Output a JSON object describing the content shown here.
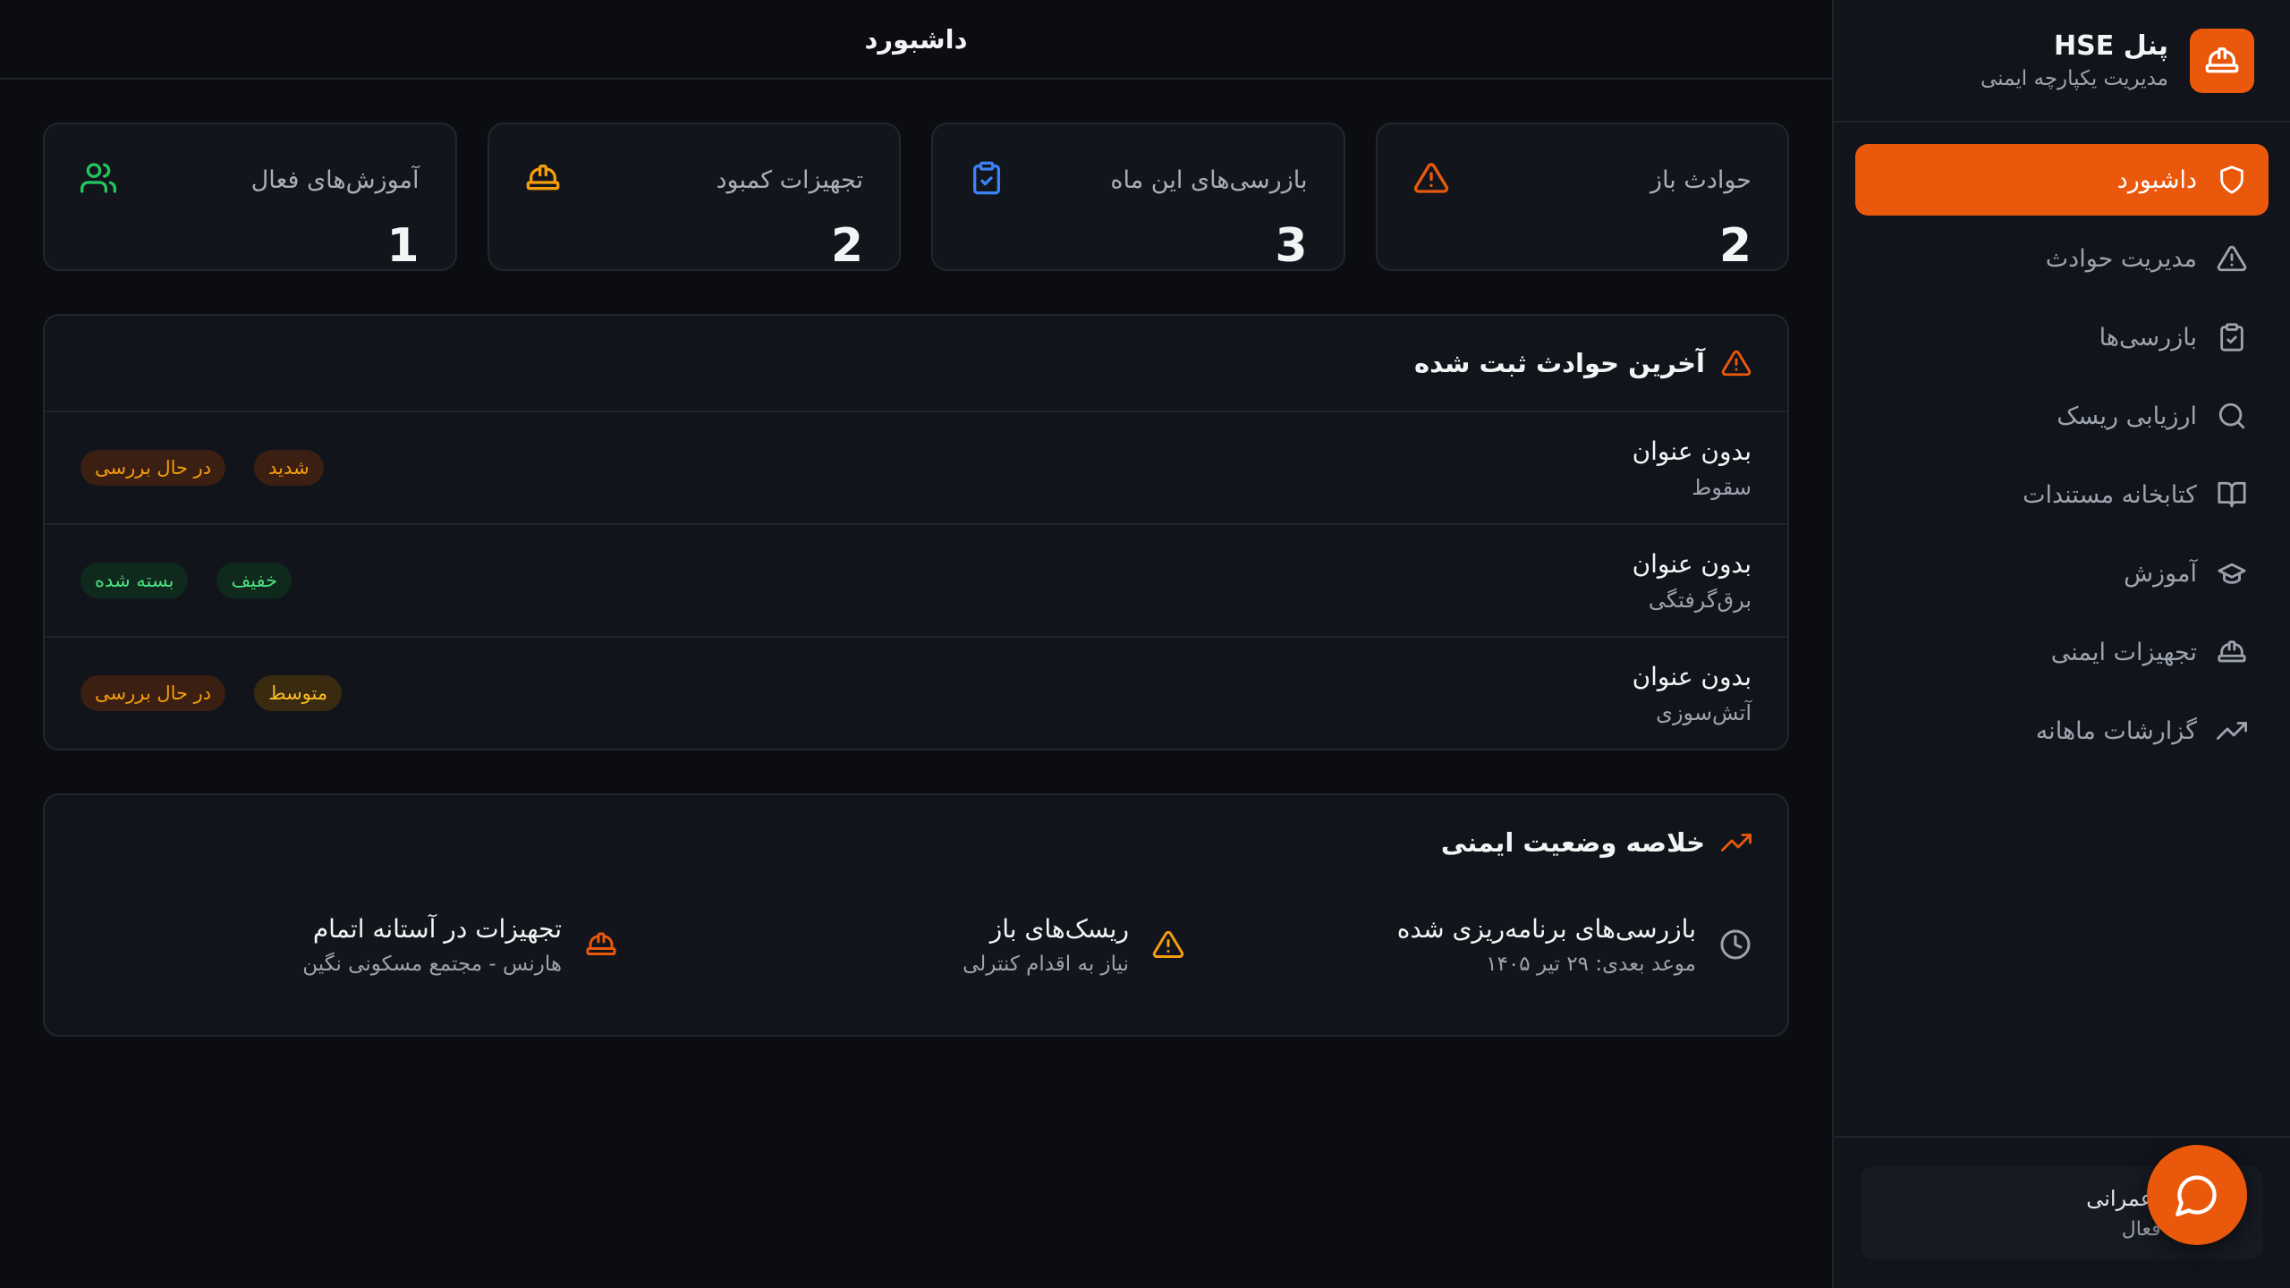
{
  "brand": {
    "title": "پنل HSE",
    "subtitle": "مدیریت یکپارچه ایمنی"
  },
  "sidebar": {
    "items": [
      {
        "label": "داشبورد",
        "icon": "shield-icon",
        "active": true
      },
      {
        "label": "مدیریت حوادث",
        "icon": "alert-triangle-icon"
      },
      {
        "label": "بازرسی‌ها",
        "icon": "clipboard-check-icon"
      },
      {
        "label": "ارزیابی ریسک",
        "icon": "search-icon"
      },
      {
        "label": "کتابخانه مستندات",
        "icon": "book-open-icon"
      },
      {
        "label": "آموزش",
        "icon": "graduation-cap-icon"
      },
      {
        "label": "تجهیزات ایمنی",
        "icon": "hard-hat-icon"
      },
      {
        "label": "گزارشات ماهانه",
        "icon": "trending-up-icon"
      }
    ],
    "project": {
      "name": "ه‌های عمرانی",
      "status": "روژه فعال"
    }
  },
  "header": {
    "title": "داشبورد"
  },
  "stats": [
    {
      "label": "حوادث باز",
      "value": "2",
      "icon": "alert-triangle-icon",
      "color": "#ea580c"
    },
    {
      "label": "بازرسی‌های این ماه",
      "value": "3",
      "icon": "clipboard-check-icon",
      "color": "#3b82f6"
    },
    {
      "label": "تجهیزات کمبود",
      "value": "2",
      "icon": "hard-hat-icon",
      "color": "#f59e0b"
    },
    {
      "label": "آموزش‌های فعال",
      "value": "1",
      "icon": "users-icon",
      "color": "#22c55e"
    }
  ],
  "incidents": {
    "title": "آخرین حوادث ثبت شده",
    "rows": [
      {
        "title": "بدون عنوان",
        "type": "سقوط",
        "severity": "شدید",
        "status": "در حال بررسی"
      },
      {
        "title": "بدون عنوان",
        "type": "برق‌گرفتگی",
        "severity": "خفیف",
        "status": "بسته شده"
      },
      {
        "title": "بدون عنوان",
        "type": "آتش‌سوزی",
        "severity": "متوسط",
        "status": "در حال بررسی"
      }
    ]
  },
  "summary": {
    "title": "خلاصه وضعیت ایمنی",
    "items": [
      {
        "title": "بازرسی‌های برنامه‌ریزی شده",
        "subtitle": "موعد بعدی: ۲۹ تیر ۱۴۰۵",
        "icon": "clock-icon"
      },
      {
        "title": "ریسک‌های باز",
        "subtitle": "نیاز به اقدام کنترلی",
        "icon": "alert-triangle-icon"
      },
      {
        "title": "تجهیزات در آستانه اتمام",
        "subtitle": "هارنس - مجتمع مسکونی نگین",
        "icon": "hard-hat-icon"
      }
    ]
  },
  "colors": {
    "accent": "#ea580c",
    "background": "#0b0d11",
    "sidebar": "#11141a"
  }
}
